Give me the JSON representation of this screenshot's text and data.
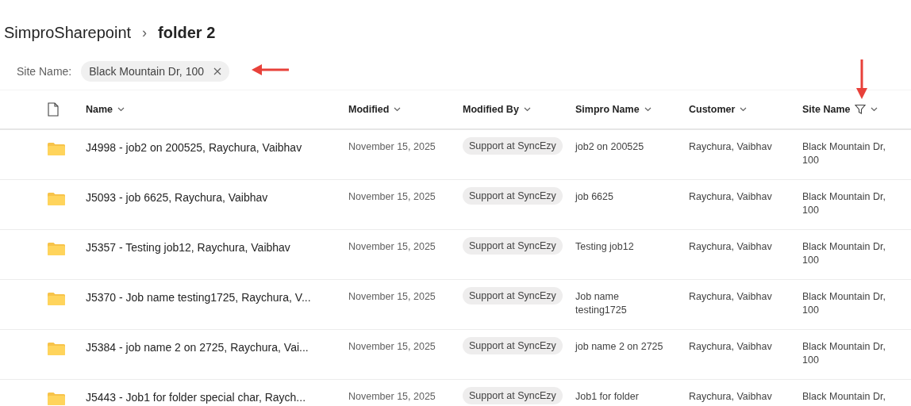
{
  "breadcrumb": {
    "parent": "SimproSharepoint",
    "separator": "›",
    "current": "folder 2"
  },
  "filter": {
    "label": "Site Name:",
    "value": "Black Mountain Dr, 100"
  },
  "table": {
    "columns": [
      {
        "label": "Name",
        "filtered": false
      },
      {
        "label": "Modified",
        "filtered": false
      },
      {
        "label": "Modified By",
        "filtered": false
      },
      {
        "label": "Simpro Name",
        "filtered": false
      },
      {
        "label": "Customer",
        "filtered": false
      },
      {
        "label": "Site Name",
        "filtered": true
      }
    ],
    "rows": [
      {
        "name": "J4998 - job2 on 200525, Raychura, Vaibhav",
        "modified": "November 15, 2025",
        "modified_by": "Support at SyncEzy",
        "simpro_name": "job2 on 200525",
        "customer": "Raychura, Vaibhav",
        "site_name": "Black Mountain Dr, 100"
      },
      {
        "name": "J5093 - job 6625, Raychura, Vaibhav",
        "modified": "November 15, 2025",
        "modified_by": "Support at SyncEzy",
        "simpro_name": "job 6625",
        "customer": "Raychura, Vaibhav",
        "site_name": "Black Mountain Dr, 100"
      },
      {
        "name": "J5357 - Testing job12, Raychura, Vaibhav",
        "modified": "November 15, 2025",
        "modified_by": "Support at SyncEzy",
        "simpro_name": "Testing job12",
        "customer": "Raychura, Vaibhav",
        "site_name": "Black Mountain Dr, 100"
      },
      {
        "name": "J5370 - Job name testing1725, Raychura, V...",
        "modified": "November 15, 2025",
        "modified_by": "Support at SyncEzy",
        "simpro_name": "Job name testing1725",
        "customer": "Raychura, Vaibhav",
        "site_name": "Black Mountain Dr, 100"
      },
      {
        "name": "J5384 - job name 2 on 2725, Raychura, Vai...",
        "modified": "November 15, 2025",
        "modified_by": "Support at SyncEzy",
        "simpro_name": "job name 2 on 2725",
        "customer": "Raychura, Vaibhav",
        "site_name": "Black Mountain Dr, 100"
      },
      {
        "name": "J5443 - Job1 for folder special char, Raych...",
        "modified": "November 15, 2025",
        "modified_by": "Support at SyncEzy",
        "simpro_name": "Job1 for folder",
        "customer": "Raychura, Vaibhav",
        "site_name": "Black Mountain Dr,"
      }
    ]
  }
}
